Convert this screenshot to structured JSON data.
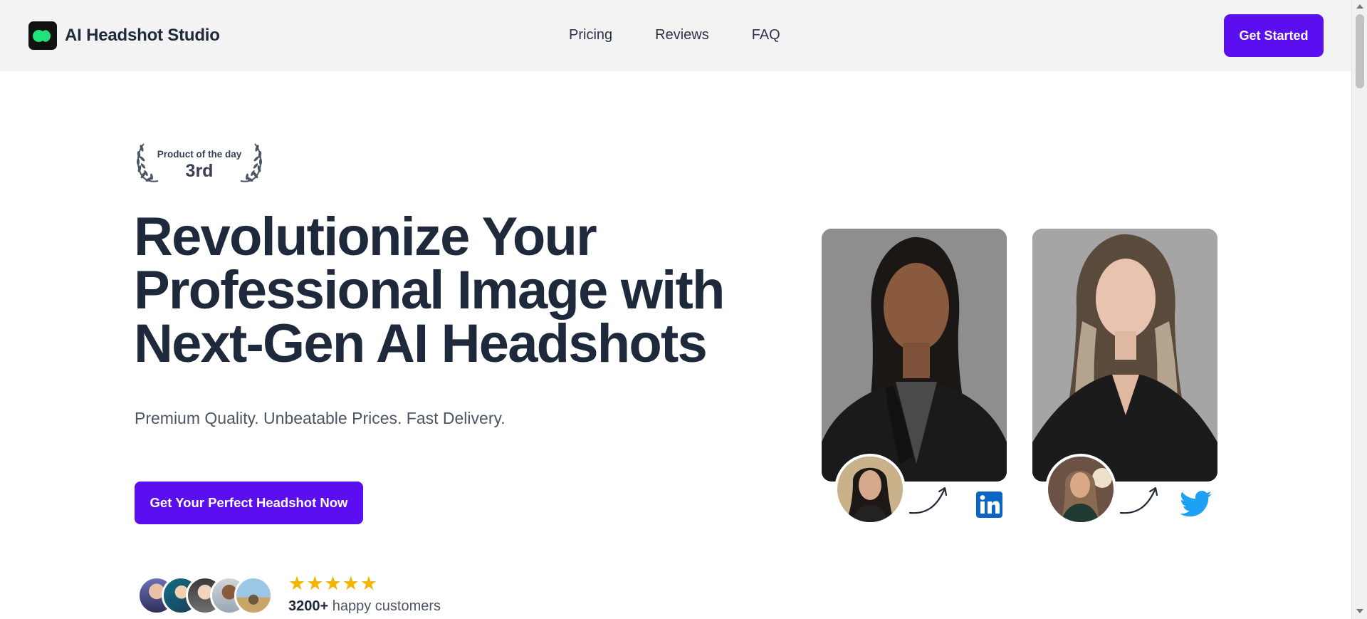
{
  "header": {
    "brand_name": "AI Headshot Studio",
    "nav": [
      "Pricing",
      "Reviews",
      "FAQ"
    ],
    "cta_label": "Get Started"
  },
  "badge": {
    "label": "Product of the day",
    "rank": "3rd"
  },
  "hero": {
    "title_lines": [
      "Revolutionize Your",
      "Professional Image with",
      "Next-Gen AI Headshots"
    ],
    "subtitle": "Premium Quality. Unbeatable Prices. Fast Delivery.",
    "cta_label": "Get Your Perfect Headshot Now"
  },
  "social_proof": {
    "rating_stars": 5,
    "customer_count": "3200+",
    "customer_text": "happy customers"
  },
  "showcase": {
    "examples": [
      {
        "platform": "linkedin-icon"
      },
      {
        "platform": "twitter-icon"
      }
    ]
  },
  "colors": {
    "accent": "#5b0ef0",
    "brand_green": "#22e37a",
    "star": "#f5b400",
    "linkedin": "#0a66c2",
    "twitter": "#1da1f2",
    "header_bg": "#f3f3f3"
  }
}
